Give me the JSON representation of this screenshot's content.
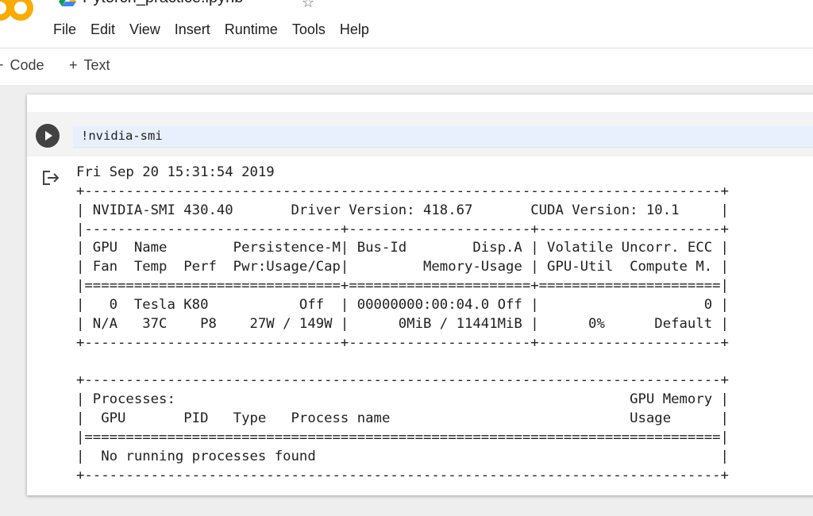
{
  "notebook": {
    "title": "Pytorch_practice.ipynb"
  },
  "menu": {
    "items": [
      "File",
      "Edit",
      "View",
      "Insert",
      "Runtime",
      "Tools",
      "Help"
    ]
  },
  "toolbar": {
    "code_label": "Code",
    "text_label": "Text",
    "plus_symbol": "+"
  },
  "cell": {
    "code": "!nvidia-smi",
    "output_lines": [
      "Fri Sep 20 15:31:54 2019",
      "+-----------------------------------------------------------------------------+",
      "| NVIDIA-SMI 430.40       Driver Version: 418.67       CUDA Version: 10.1     |",
      "|-------------------------------+----------------------+----------------------+",
      "| GPU  Name        Persistence-M| Bus-Id        Disp.A | Volatile Uncorr. ECC |",
      "| Fan  Temp  Perf  Pwr:Usage/Cap|         Memory-Usage | GPU-Util  Compute M. |",
      "|===============================+======================+======================|",
      "|   0  Tesla K80           Off  | 00000000:00:04.0 Off |                    0 |",
      "| N/A   37C    P8    27W / 149W |      0MiB / 11441MiB |      0%      Default |",
      "+-------------------------------+----------------------+----------------------+",
      "",
      "+-----------------------------------------------------------------------------+",
      "| Processes:                                                       GPU Memory |",
      "|  GPU       PID   Type   Process name                             Usage      |",
      "|=============================================================================|",
      "|  No running processes found                                                 |",
      "+-----------------------------------------------------------------------------+"
    ]
  },
  "colors": {
    "logo_orange": "#F9AB00",
    "run_button": "#424242",
    "notebook_bg": "#eeeeee"
  },
  "icons": {
    "logo": "colab-logo-icon",
    "drive": "google-drive-icon",
    "star": "star-icon",
    "run": "play-icon",
    "output": "output-exit-icon"
  }
}
